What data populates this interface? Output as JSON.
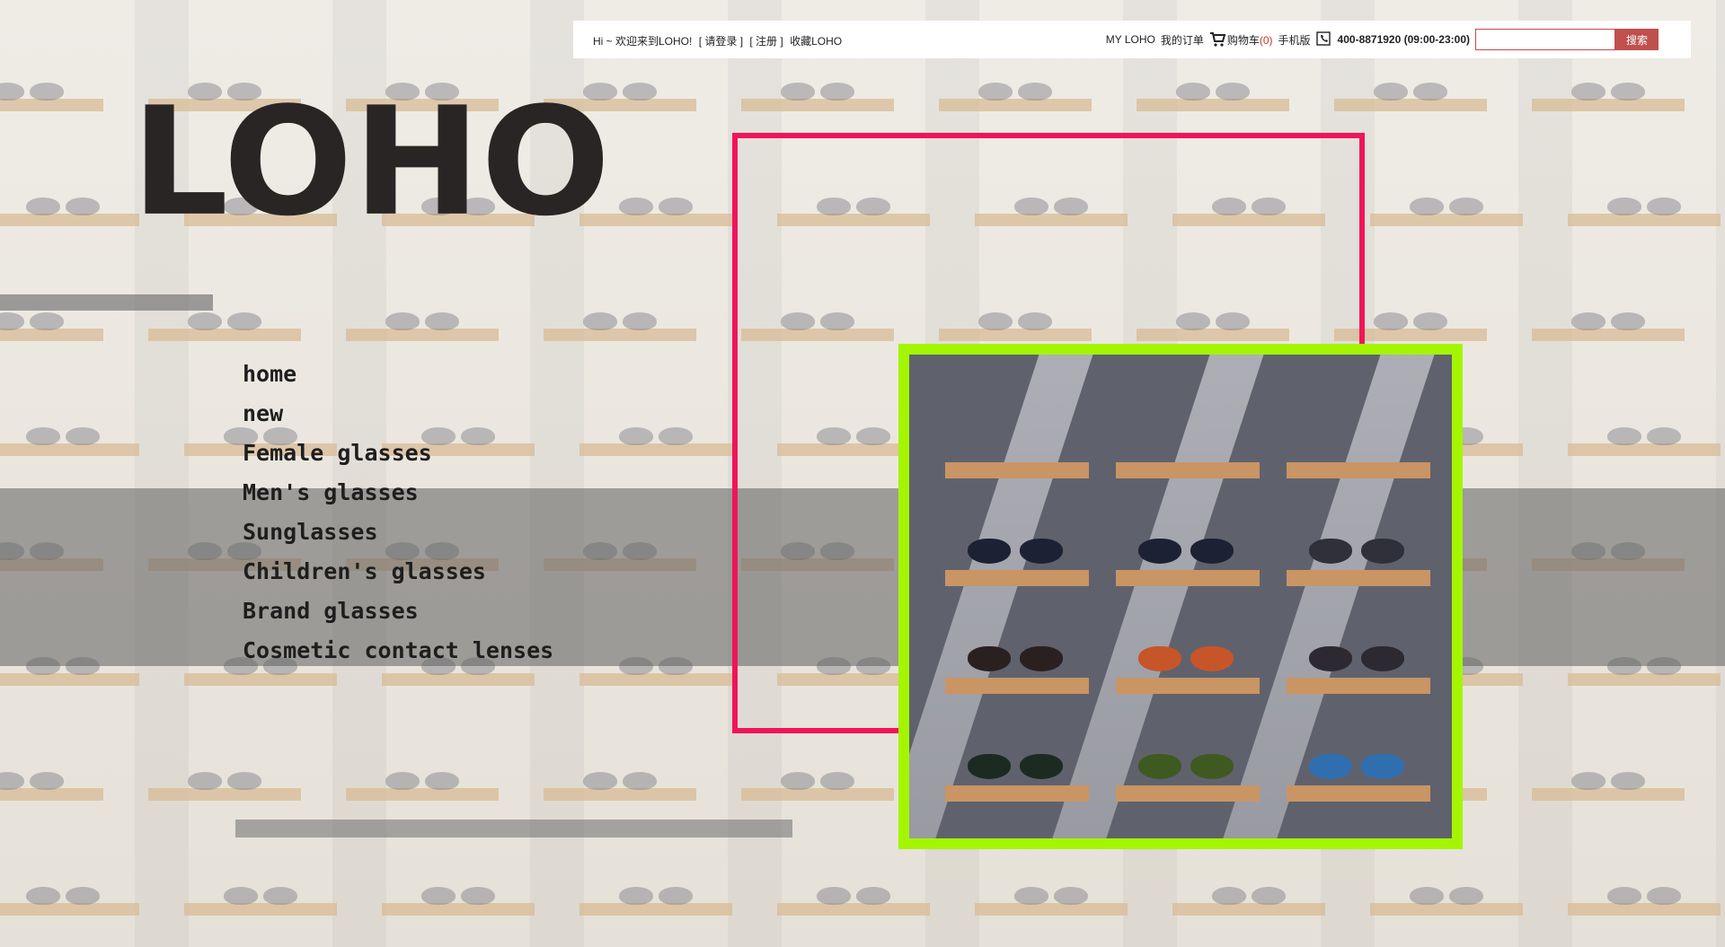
{
  "topbar": {
    "welcome": "Hi ~ 欢迎来到LOHO!",
    "login": "[ 请登录 ]",
    "register": "[ 注册 ]",
    "favorite": "收藏LOHO",
    "my_loho": "MY LOHO",
    "orders": "我的订单",
    "cart_label": "购物车",
    "cart_count": "(0)",
    "mobile": "手机版",
    "phone": "400-8871920 (09:00-23:00)",
    "search_placeholder": "",
    "search_button": "搜索"
  },
  "logo": {
    "text": "LOHO"
  },
  "nav": {
    "items": [
      "home",
      "new",
      "Female glasses",
      "Men's glasses",
      "Sunglasses",
      "Children's glasses",
      "Brand glasses",
      "Cosmetic contact lenses"
    ]
  },
  "colors": {
    "pink_frame": "#f0145a",
    "green_frame": "#a4f501",
    "search_button": "#c0504d",
    "cart_count": "#c0392b"
  },
  "icons": {
    "cart": "shopping-cart-icon",
    "phone": "phone-icon"
  }
}
